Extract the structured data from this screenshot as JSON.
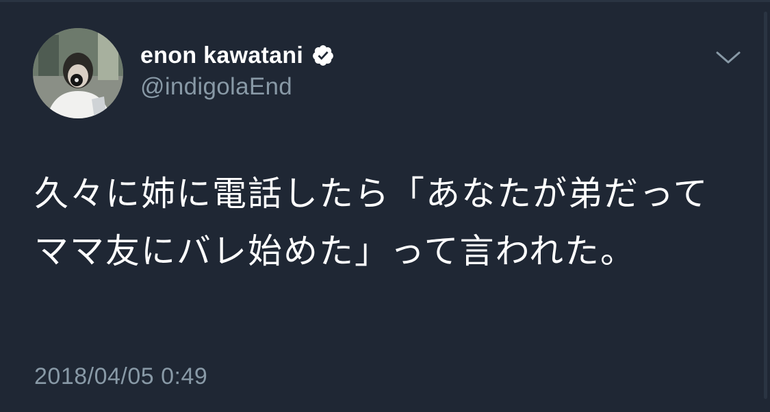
{
  "tweet": {
    "author": {
      "display_name": "enon kawatani",
      "handle": "@indigolaEnd",
      "verified": true
    },
    "text": "久々に姉に電話したら「あなたが弟だってママ友にバレ始めた」って言われた。",
    "timestamp": "2018/04/05 0:49"
  },
  "icons": {
    "verified": "verified-badge-icon",
    "menu": "chevron-down-icon"
  },
  "colors": {
    "background": "#1f2734",
    "primary_text": "#ffffff",
    "secondary_text": "#8899a6"
  }
}
